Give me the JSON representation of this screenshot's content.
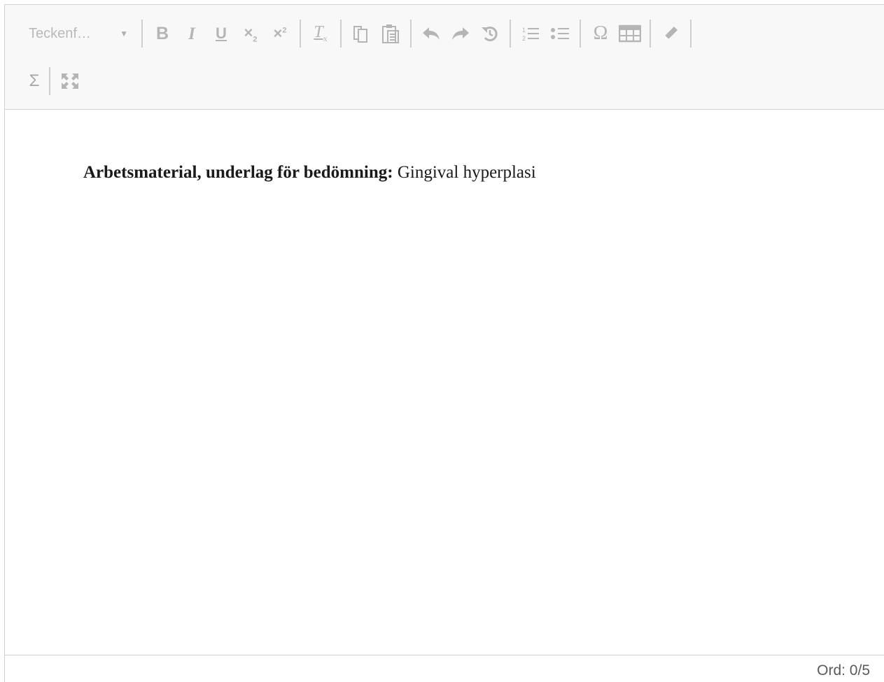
{
  "toolbar": {
    "font_family_label": "Teckenf…",
    "font_family_caret": "▼",
    "superscript_glyph": "2",
    "subscript_glyph": "2",
    "omega_glyph": "Ω",
    "sigma_glyph": "Σ",
    "bold_glyph": "B",
    "italic_glyph": "I",
    "underline_glyph": "U"
  },
  "editor": {
    "content_bold": "Arbetsmaterial, underlag för bedömning:",
    "content_text": " Gingival hyperplasi"
  },
  "statusbar": {
    "word_count": "Ord: 0/5"
  },
  "colors": {
    "toolbar_bg": "#f8f8f8",
    "icon_gray": "#b5b5b5",
    "border": "#d1d1d1",
    "text": "#1a1a1a"
  }
}
